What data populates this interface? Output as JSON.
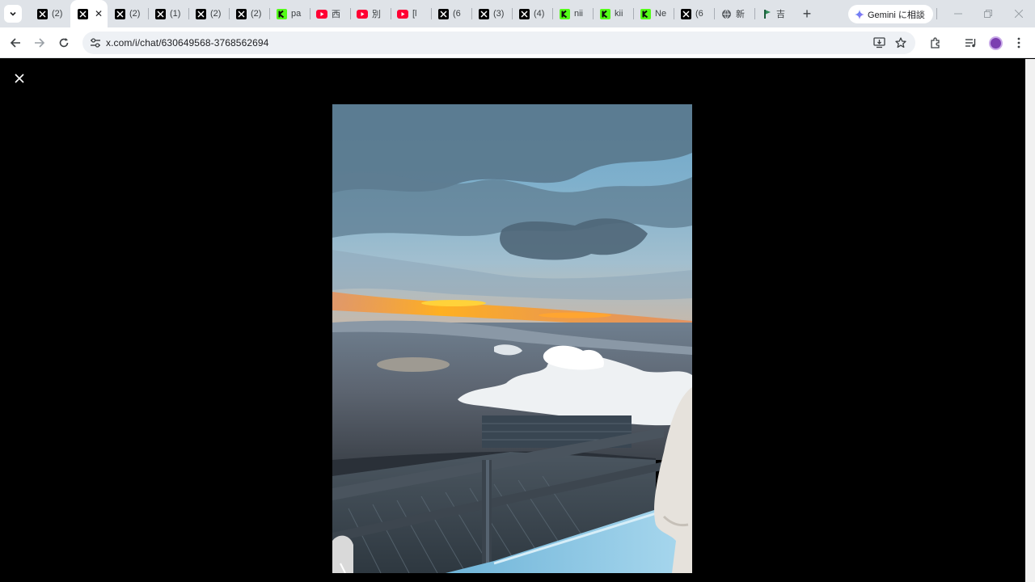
{
  "browser": {
    "tabs": [
      {
        "icon": "x-logo-icon",
        "title": "(2)"
      },
      {
        "icon": "x-logo-icon",
        "title": "",
        "active": true
      },
      {
        "icon": "x-logo-icon",
        "title": "(2)"
      },
      {
        "icon": "x-logo-icon",
        "title": "(1)"
      },
      {
        "icon": "x-logo-icon",
        "title": "(2)"
      },
      {
        "icon": "x-logo-icon",
        "title": "(2)"
      },
      {
        "icon": "kick-logo-icon",
        "title": "pa"
      },
      {
        "icon": "youtube-logo-icon",
        "title": "西"
      },
      {
        "icon": "youtube-logo-icon",
        "title": "別"
      },
      {
        "icon": "youtube-logo-icon",
        "title": "[l"
      },
      {
        "icon": "x-logo-icon",
        "title": "(6"
      },
      {
        "icon": "x-logo-icon",
        "title": "(3)"
      },
      {
        "icon": "x-logo-icon",
        "title": "(4)"
      },
      {
        "icon": "kick-logo-icon",
        "title": "nii"
      },
      {
        "icon": "kick-logo-icon",
        "title": "kii"
      },
      {
        "icon": "kick-logo-icon",
        "title": "Ne"
      },
      {
        "icon": "x-logo-icon",
        "title": "(6"
      },
      {
        "icon": "globe-icon",
        "title": "新"
      },
      {
        "icon": "flag-icon",
        "title": "吉"
      }
    ],
    "active_tab_close": "✕",
    "new_tab": "+",
    "gemini_label": "Gemini に相談",
    "address": {
      "url": "x.com/i/chat/630649568-3768562694"
    }
  },
  "viewer": {
    "close_label": "✕"
  },
  "colors": {
    "tabstrip_bg": "#dfe3e8",
    "omnibox_bg": "#eef1f5",
    "kick_green": "#53fc18",
    "youtube_red": "#ff0033",
    "avatar_purple": "#7b3fb0"
  }
}
